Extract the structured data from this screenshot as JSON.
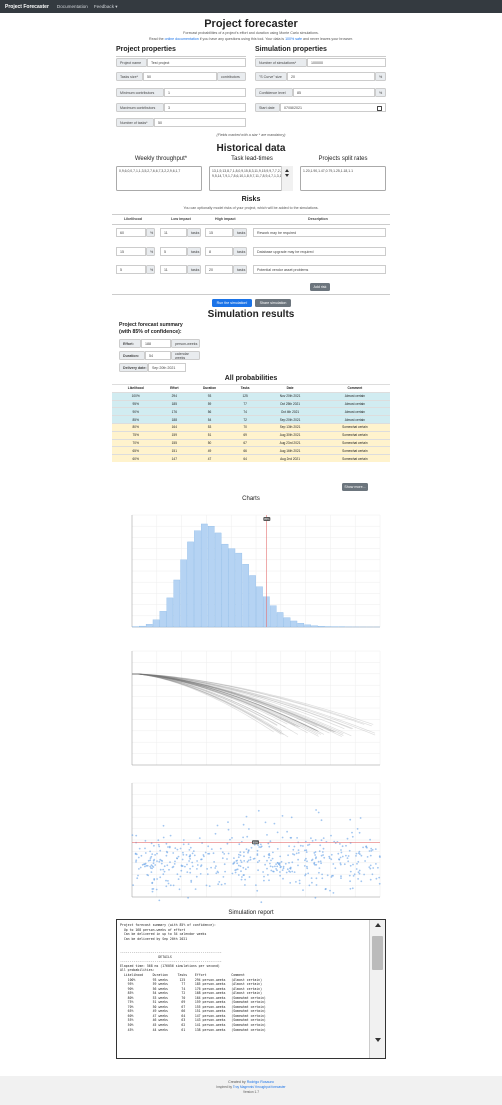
{
  "nav": {
    "brand": "Project Forecaster",
    "documentation": "Documentation",
    "feedback": "Feedback ▾"
  },
  "header": {
    "title": "Project forecaster",
    "sub1": "Forecast probabilities of a project's effort and duration using Monte Carlo simulations.",
    "sub2_pre": "Read the",
    "sub2_link1": "online documentation",
    "sub2_mid": "if you have any questions using this tool. Your data is",
    "sub2_link2": "100% safe",
    "sub2_post": "and never leaves your browser."
  },
  "project": {
    "heading": "Project properties",
    "name_label": "Project name",
    "name_value": "Test project",
    "tasks_label": "Tasks size*",
    "tasks_value": "50",
    "tasks_unit": "contributors",
    "min_label": "Minimum contributors",
    "min_value": "1",
    "max_label": "Maximum contributors",
    "max_value": "3",
    "tasks_count_label": "Number of tasks*",
    "tasks_count_value": "50"
  },
  "simulation": {
    "heading": "Simulation properties",
    "num_label": "Number of simulations*",
    "num_value": "100000",
    "scurve_label": "\"S Curve\" size",
    "scurve_value": "20",
    "scurve_unit": "%",
    "conf_label": "Confidence level",
    "conf_value": "85",
    "conf_unit": "%",
    "start_label": "Start date",
    "start_value": "07/08/2021"
  },
  "mandatory_note": "(Fields marked with a star * are mandatory)",
  "historical": {
    "heading": "Historical data",
    "throughput_title": "Weekly throughput*",
    "throughput_value": "0,9,6,0,0,7,1,1,3,5,2,7,6,6,7,3,2,2,9,6,1,7",
    "leadtimes_title": "Task lead-times",
    "leadtimes_value": "13,1,9,13,8,7,1,8,0,9,15,8,3,11,9,15,9,9,7,7,2,2,1,2,9,5,14,7,9,1,7,8,6,10,1,8,9,7,11,7,8,9,4,7,1,3,1,3",
    "split_title": "Projects split rates",
    "split_value": "1.20,1.90,1.47,0.79,1.25,1.18,1.1"
  },
  "risks": {
    "heading": "Risks",
    "sub": "You can optionally model risks of your project, which will be added to the simulations.",
    "cols": [
      "Likelihood",
      "Low impact",
      "High impact",
      "Description"
    ],
    "rows": [
      {
        "likelihood": "60",
        "low": "11",
        "high": "15",
        "desc": "Rework may be required"
      },
      {
        "likelihood": "15",
        "low": "5",
        "high": "8",
        "desc": "Database upgrade may be required"
      },
      {
        "likelihood": "5",
        "low": "11",
        "high": "20",
        "desc": "Potential vendor asset problems"
      }
    ],
    "pct": "%",
    "tasks": "tasks",
    "add": "Add risk"
  },
  "buttons": {
    "run": "Run the simulation!",
    "share": "Share simulation"
  },
  "results": {
    "heading": "Simulation results",
    "summary_title1": "Project forecast summary",
    "summary_title2": "(with 85% of confidence):",
    "effort_label": "Effort:",
    "effort_value": "188",
    "effort_unit": "person-weeks",
    "duration_label": "Duration:",
    "duration_value": "54",
    "duration_unit": "calendar weeks",
    "delivery_label": "Delivery date:",
    "delivery_value": "Sep 20th 2021"
  },
  "probabilities": {
    "heading": "All probabilities",
    "cols": [
      "Likelihood",
      "Effort",
      "Duration",
      "Tasks",
      "Date",
      "Comment"
    ],
    "rows": [
      {
        "l": "100%",
        "e": "294",
        "d": "93",
        "t": "125",
        "date": "Nov 20th 2021",
        "c": "Almost certain",
        "tone": "blue"
      },
      {
        "l": "95%",
        "e": "185",
        "d": "59",
        "t": "77",
        "date": "Oct 25th 2021",
        "c": "Almost certain",
        "tone": "blue"
      },
      {
        "l": "90%",
        "e": "176",
        "d": "56",
        "t": "74",
        "date": "Oct 4th 2021",
        "c": "Almost certain",
        "tone": "blue"
      },
      {
        "l": "85%",
        "e": "188",
        "d": "54",
        "t": "72",
        "date": "Sep 20th 2021",
        "c": "Almost certain",
        "tone": "blue"
      },
      {
        "l": "80%",
        "e": "164",
        "d": "53",
        "t": "70",
        "date": "Sep 13th 2021",
        "c": "Somewhat certain",
        "tone": "yellow"
      },
      {
        "l": "75%",
        "e": "159",
        "d": "51",
        "t": "69",
        "date": "Aug 30th 2021",
        "c": "Somewhat certain",
        "tone": "yellow"
      },
      {
        "l": "70%",
        "e": "155",
        "d": "50",
        "t": "67",
        "date": "Aug 23rd 2021",
        "c": "Somewhat certain",
        "tone": "yellow"
      },
      {
        "l": "65%",
        "e": "151",
        "d": "49",
        "t": "66",
        "date": "Aug 16th 2021",
        "c": "Somewhat certain",
        "tone": "yellow"
      },
      {
        "l": "60%",
        "e": "147",
        "d": "47",
        "t": "64",
        "date": "Aug 2nd 2021",
        "c": "Somewhat certain",
        "tone": "yellow"
      }
    ],
    "more": "Show more..."
  },
  "charts": {
    "heading": "Charts"
  },
  "chart_data": [
    {
      "type": "bar",
      "x": [
        35,
        36,
        37,
        38,
        39,
        40,
        41,
        42,
        43,
        44,
        45,
        46,
        47,
        48,
        49,
        50,
        51,
        52,
        53,
        54,
        55,
        56,
        57,
        58,
        59,
        60,
        61,
        62,
        63,
        64,
        65,
        66,
        67,
        68,
        69,
        70
      ],
      "values": [
        10,
        40,
        120,
        320,
        700,
        1300,
        2100,
        3000,
        3800,
        4300,
        4600,
        4500,
        4200,
        3700,
        3500,
        3300,
        2800,
        2300,
        1800,
        1350,
        950,
        650,
        420,
        270,
        170,
        100,
        60,
        35,
        20,
        12,
        8,
        5,
        3,
        2,
        1,
        1
      ],
      "ylim": [
        0,
        5000
      ],
      "marker": 54,
      "marker_label": "85%"
    },
    {
      "type": "line",
      "series_count": 40,
      "ylim": [
        0,
        100
      ],
      "xlim": [
        0,
        60
      ]
    },
    {
      "type": "scatter",
      "point_count": 500,
      "ylim": [
        30,
        80
      ],
      "marker_y": 54,
      "marker_label": "85%"
    }
  ],
  "report": {
    "heading": "Simulation report",
    "text": "Project forecast summary (with 85% of confidence):\n  Up to 168 person-weeks of effort\n  Can be delivered in up to 54 calendar weeks\n  Can be delivered by Sep 20th 2021\n\n\n-----------------------------------------------------\n                    DETAILS\n-----------------------------------------------------\nElapsed time: 568 ms (176056 simulations per second)\nAll probabilities:\n  Likelihood     Duration     Tasks    Effort             Comment\n    100%         93 weeks      125     294 person-weeks   (Almost certain)\n    95%          59 weeks       77     185 person-weeks   (Almost certain)\n    90%          56 weeks       74     176 person-weeks   (Almost certain)\n    85%          54 weeks       72     168 person-weeks   (Almost certain)\n    80%          53 weeks       70     164 person-weeks   (Somewhat certain)\n    75%          51 weeks       69     159 person-weeks   (Somewhat certain)\n    70%          50 weeks       67     155 person-weeks   (Somewhat certain)\n    65%          49 weeks       66     151 person-weeks   (Somewhat certain)\n    60%          47 weeks       64     147 person-weeks   (Somewhat certain)\n    55%          46 weeks       63     143 person-weeks   (Somewhat certain)\n    50%          45 weeks       62     141 person-weeks   (Somewhat certain)\n    45%          44 weeks       61     138 person-weeks   (Somewhat certain)"
  },
  "footer": {
    "line1_pre": "Created by",
    "line1_link": "Rodrigo Rosauro",
    "line2_pre": "Inspired by",
    "line2_link": "Troy Magennis' throughput forecaster",
    "version": "Version 1.7"
  }
}
